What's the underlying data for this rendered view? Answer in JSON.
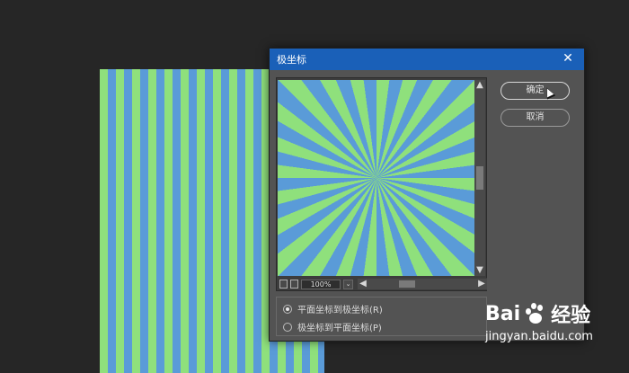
{
  "dialog": {
    "title": "极坐标",
    "close_symbol": "✕",
    "ok_label": "确定",
    "cancel_label": "取消",
    "zoom_value": "100%",
    "options": [
      {
        "label": "平面坐标到极坐标(R)",
        "checked": true
      },
      {
        "label": "极坐标到平面坐标(P)",
        "checked": false
      }
    ]
  },
  "icons": {
    "scroll_up": "▲",
    "scroll_down": "▼",
    "scroll_left": "◀",
    "scroll_right": "▶",
    "dropdown": "⌄"
  },
  "watermark": {
    "logo_left": "Bai",
    "logo_right": "经验",
    "url": "jingyan.baidu.com"
  },
  "colors": {
    "stripe_green": "#8fe07c",
    "stripe_blue": "#5a9bd8",
    "title_bar": "#1a60b8"
  }
}
